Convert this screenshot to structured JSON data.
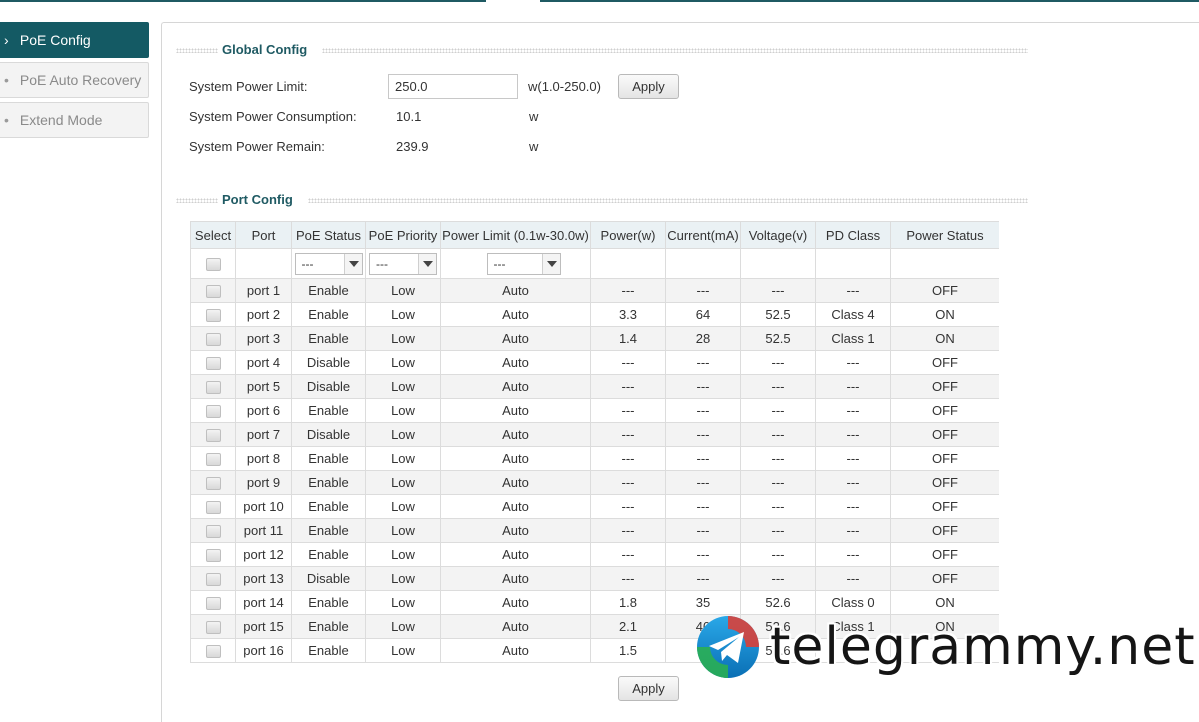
{
  "sidebar": {
    "items": [
      {
        "label": "PoE Config",
        "active": true
      },
      {
        "label": "PoE Auto Recovery",
        "active": false
      },
      {
        "label": "Extend Mode",
        "active": false
      }
    ]
  },
  "global_config": {
    "title": "Global Config",
    "power_limit_label": "System Power Limit:",
    "power_limit_value": "250.0",
    "power_limit_range": "w(1.0-250.0)",
    "apply_label": "Apply",
    "consumption_label": "System Power Consumption:",
    "consumption_value": "10.1",
    "consumption_unit": "w",
    "remain_label": "System Power Remain:",
    "remain_value": "239.9",
    "remain_unit": "w"
  },
  "port_config": {
    "title": "Port Config",
    "columns": [
      "Select",
      "Port",
      "PoE Status",
      "PoE Priority",
      "Power Limit (0.1w-30.0w)",
      "Power(w)",
      "Current(mA)",
      "Voltage(v)",
      "PD Class",
      "Power Status"
    ],
    "filter_placeholder": "---",
    "rows": [
      [
        "port 1",
        "Enable",
        "Low",
        "Auto",
        "---",
        "---",
        "---",
        "---",
        "OFF"
      ],
      [
        "port 2",
        "Enable",
        "Low",
        "Auto",
        "3.3",
        "64",
        "52.5",
        "Class 4",
        "ON"
      ],
      [
        "port 3",
        "Enable",
        "Low",
        "Auto",
        "1.4",
        "28",
        "52.5",
        "Class 1",
        "ON"
      ],
      [
        "port 4",
        "Disable",
        "Low",
        "Auto",
        "---",
        "---",
        "---",
        "---",
        "OFF"
      ],
      [
        "port 5",
        "Disable",
        "Low",
        "Auto",
        "---",
        "---",
        "---",
        "---",
        "OFF"
      ],
      [
        "port 6",
        "Enable",
        "Low",
        "Auto",
        "---",
        "---",
        "---",
        "---",
        "OFF"
      ],
      [
        "port 7",
        "Disable",
        "Low",
        "Auto",
        "---",
        "---",
        "---",
        "---",
        "OFF"
      ],
      [
        "port 8",
        "Enable",
        "Low",
        "Auto",
        "---",
        "---",
        "---",
        "---",
        "OFF"
      ],
      [
        "port 9",
        "Enable",
        "Low",
        "Auto",
        "---",
        "---",
        "---",
        "---",
        "OFF"
      ],
      [
        "port 10",
        "Enable",
        "Low",
        "Auto",
        "---",
        "---",
        "---",
        "---",
        "OFF"
      ],
      [
        "port 11",
        "Enable",
        "Low",
        "Auto",
        "---",
        "---",
        "---",
        "---",
        "OFF"
      ],
      [
        "port 12",
        "Enable",
        "Low",
        "Auto",
        "---",
        "---",
        "---",
        "---",
        "OFF"
      ],
      [
        "port 13",
        "Disable",
        "Low",
        "Auto",
        "---",
        "---",
        "---",
        "---",
        "OFF"
      ],
      [
        "port 14",
        "Enable",
        "Low",
        "Auto",
        "1.8",
        "35",
        "52.6",
        "Class 0",
        "ON"
      ],
      [
        "port 15",
        "Enable",
        "Low",
        "Auto",
        "2.1",
        "40",
        "52.6",
        "Class 1",
        "ON"
      ],
      [
        "port 16",
        "Enable",
        "Low",
        "Auto",
        "1.5",
        "",
        "51.6",
        "",
        ""
      ]
    ],
    "apply_label": "Apply"
  },
  "watermark": {
    "text": "telegrammy.net",
    "icon": "telegram-icon"
  },
  "colors": {
    "accent": "#145a64",
    "section_title": "#1f5a63",
    "table_header": "#eaf1f4"
  }
}
